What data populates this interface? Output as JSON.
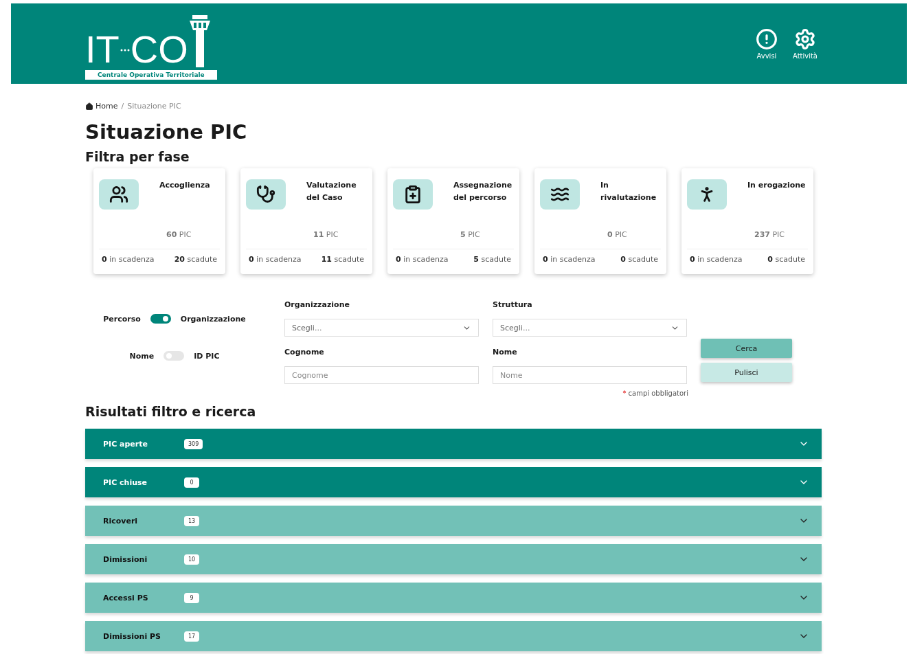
{
  "header": {
    "logo": {
      "left": "IT",
      "right": "CO",
      "tagline": "Centrale Operativa Territoriale"
    },
    "actions": [
      {
        "label": "Avvisi",
        "kind": "alert"
      },
      {
        "label": "Attività",
        "kind": "settings"
      }
    ]
  },
  "breadcrumb": [
    {
      "label": "Home",
      "kind": "home"
    },
    {
      "label": "/",
      "kind": "separator"
    },
    {
      "label": "Situazione PIC",
      "kind": "current"
    }
  ],
  "title": "Situazione PIC",
  "phase_heading": "Filtra per fase",
  "phases": [
    {
      "kind": "people",
      "title": "Accoglienza",
      "count": "**60** PIC",
      "expiring": "**0** in scadenza",
      "expired": "**20** scadute"
    },
    {
      "kind": "stethoscope",
      "title": "Valutazione del Caso",
      "count": "**11** PIC",
      "expiring": "**0** in scadenza",
      "expired": "**11** scadute"
    },
    {
      "kind": "clipboard",
      "title": "Assegnazione del percorso",
      "count": "**5** PIC",
      "expiring": "**0** in scadenza",
      "expired": "**5** scadute"
    },
    {
      "kind": "waves",
      "title": "In rivalutazione",
      "count": "**0** PIC",
      "expiring": "**0** in scadenza",
      "expired": "**0** scadute"
    },
    {
      "kind": "person",
      "title": "In erogazione",
      "count": "**237** PIC",
      "expiring": "**0** in scadenza",
      "expired": "**0** scadute"
    }
  ],
  "toggles": [
    {
      "left": "Percorso",
      "right": "Organizzazione",
      "on": true
    },
    {
      "left": "Nome",
      "right": "ID PIC",
      "on": false
    }
  ],
  "fields": [
    {
      "kind": "select",
      "label": "Organizzazione",
      "placeholder": "Scegli..."
    },
    {
      "kind": "select",
      "label": "Struttura",
      "placeholder": "Scegli..."
    },
    {
      "kind": "text",
      "label": "Cognome",
      "placeholder": "Cognome"
    },
    {
      "kind": "text",
      "label": "Nome",
      "placeholder": "Nome"
    }
  ],
  "buttons": [
    {
      "label": "Cerca",
      "kind": "primary"
    },
    {
      "label": "Pulisci",
      "kind": "secondary"
    }
  ],
  "required_note": {
    "mark": "*",
    "text": "campi obbligatori"
  },
  "results_heading": "Risultati filtro e ricerca",
  "results": [
    {
      "label": "PIC aperte",
      "count": "309",
      "kind": "dark",
      "expanded": false
    },
    {
      "label": "PIC chiuse",
      "count": "0",
      "kind": "dark",
      "expanded": false
    },
    {
      "label": "Ricoveri",
      "count": "13",
      "kind": "light",
      "expanded": false
    },
    {
      "label": "Dimissioni",
      "count": "10",
      "kind": "light",
      "expanded": false
    },
    {
      "label": "Accessi PS",
      "count": "9",
      "kind": "light",
      "expanded": false
    },
    {
      "label": "Dimissioni PS",
      "count": "17",
      "kind": "light",
      "expanded": false
    }
  ]
}
